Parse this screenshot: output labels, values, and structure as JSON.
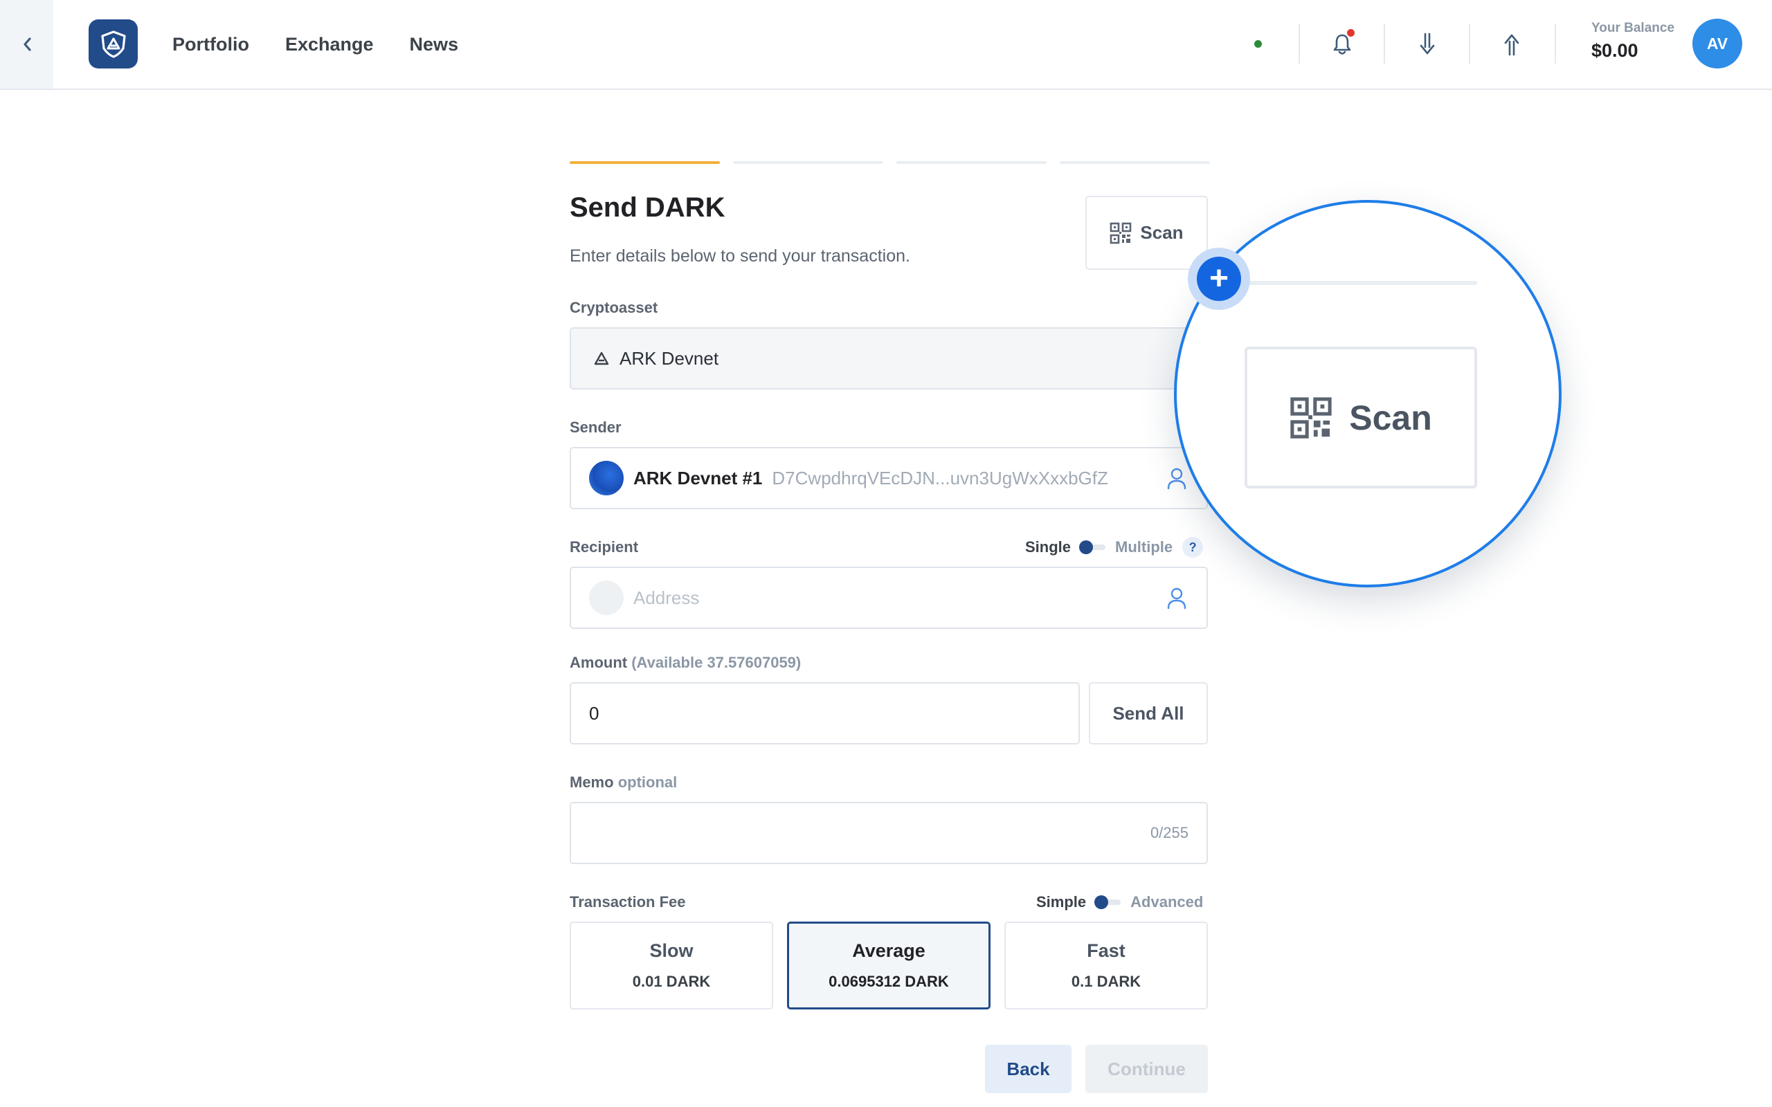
{
  "nav": {
    "back_icon": "chevron-left-icon",
    "logo_icon": "ark-shield-logo",
    "links": [
      "Portfolio",
      "Exchange",
      "News"
    ],
    "status_color": "#2b8b3b",
    "icons": [
      "bell-icon",
      "download-arrow-icon",
      "upload-arrow-icon"
    ]
  },
  "balance": {
    "label": "Your Balance",
    "value": "$0.00"
  },
  "avatar": {
    "initials": "AV",
    "color": "#2e8de6"
  },
  "steps": {
    "total": 4,
    "active": 1,
    "active_color": "#f3b03c"
  },
  "form": {
    "title": "Send DARK",
    "subtitle": "Enter details below to send your transaction.",
    "scan_label": "Scan",
    "cryptoasset": {
      "label": "Cryptoasset",
      "value": "ARK Devnet"
    },
    "sender": {
      "label": "Sender",
      "name": "ARK Devnet #1",
      "address": "D7CwpdhrqVEcDJN...uvn3UgWxXxxbGfZ"
    },
    "recipient": {
      "label": "Recipient",
      "placeholder": "Address",
      "toggle_on": "Single",
      "toggle_off": "Multiple",
      "help": "?"
    },
    "amount": {
      "label": "Amount",
      "available": "(Available 37.57607059)",
      "value": "0",
      "send_all": "Send All"
    },
    "memo": {
      "label": "Memo",
      "optional": "optional",
      "counter": "0/255"
    },
    "fee": {
      "label": "Transaction Fee",
      "toggle_on": "Simple",
      "toggle_off": "Advanced",
      "options": [
        {
          "name": "Slow",
          "amount": "0.01 DARK"
        },
        {
          "name": "Average",
          "amount": "0.0695312 DARK"
        },
        {
          "name": "Fast",
          "amount": "0.1 DARK"
        }
      ],
      "selected": "Average"
    },
    "back_label": "Back",
    "continue_label": "Continue"
  },
  "callout": {
    "scan_label": "Scan",
    "badge": "+",
    "accent": "#1e7de8"
  }
}
